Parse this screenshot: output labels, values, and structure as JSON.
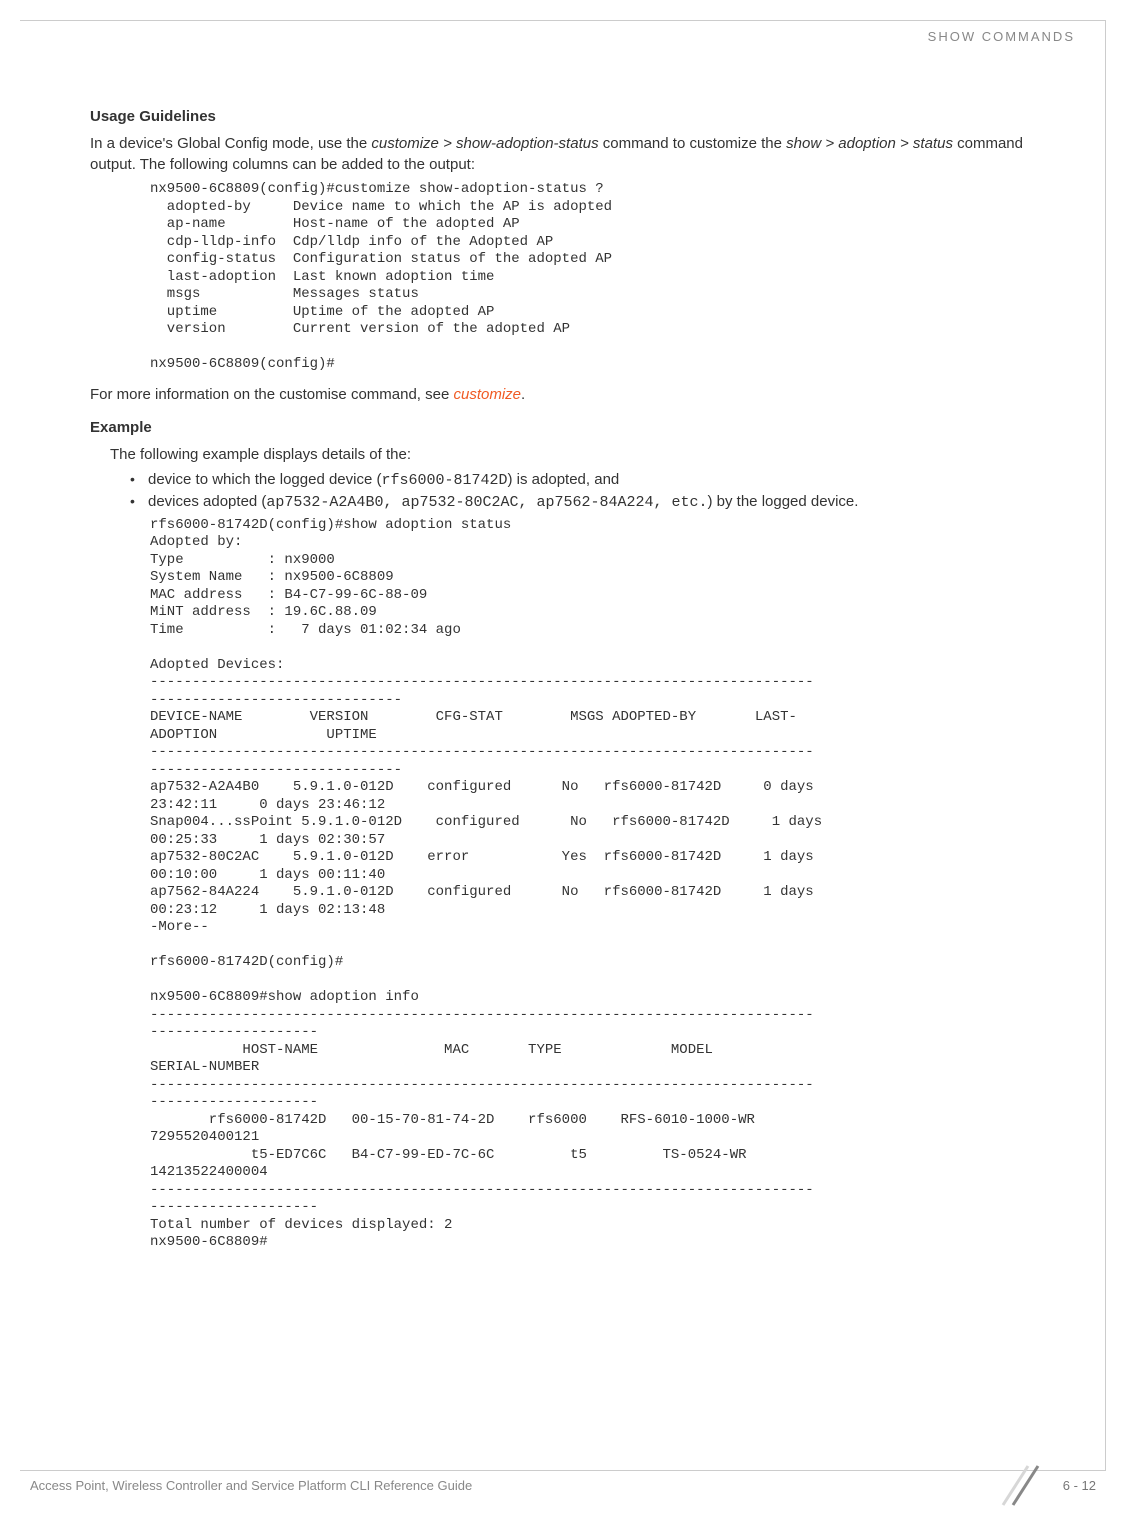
{
  "header": {
    "section_title": "SHOW COMMANDS"
  },
  "usage_guidelines": {
    "heading": "Usage Guidelines",
    "intro_part1": "In a device's Global Config mode, use the ",
    "intro_italic1": "customize > show-adoption-status",
    "intro_part2": " command to customize the ",
    "intro_italic2": "show > adoption > status",
    "intro_part3": " command output. The following columns can be added to the output:",
    "code_block": "nx9500-6C8809(config)#customize show-adoption-status ?\n  adopted-by     Device name to which the AP is adopted\n  ap-name        Host-name of the adopted AP\n  cdp-lldp-info  Cdp/lldp info of the Adopted AP\n  config-status  Configuration status of the adopted AP\n  last-adoption  Last known adoption time\n  msgs           Messages status\n  uptime         Uptime of the adopted AP\n  version        Current version of the adopted AP\n\nnx9500-6C8809(config)#",
    "footer_text_part1": "For more information on the customise command, see ",
    "footer_link": "customize",
    "footer_text_part2": "."
  },
  "example": {
    "heading": "Example",
    "intro": "The following example displays details of the:",
    "bullet1_part1": "device to which the logged device (",
    "bullet1_code": "rfs6000-81742D",
    "bullet1_part2": ") is adopted, and",
    "bullet2_part1": "devices adopted (",
    "bullet2_code": "ap7532-A2A4B0, ap7532-80C2AC, ap7562-84A224, etc.",
    "bullet2_part2": ") by the logged device.",
    "code_block": "rfs6000-81742D(config)#show adoption status\nAdopted by:\nType          : nx9000\nSystem Name   : nx9500-6C8809\nMAC address   : B4-C7-99-6C-88-09\nMiNT address  : 19.6C.88.09\nTime          :   7 days 01:02:34 ago\n\nAdopted Devices:\n-------------------------------------------------------------------------------\n------------------------------\nDEVICE-NAME        VERSION        CFG-STAT        MSGS ADOPTED-BY       LAST-\nADOPTION             UPTIME\n-------------------------------------------------------------------------------\n------------------------------\nap7532-A2A4B0    5.9.1.0-012D    configured      No   rfs6000-81742D     0 days \n23:42:11     0 days 23:46:12\nSnap004...ssPoint 5.9.1.0-012D    configured      No   rfs6000-81742D     1 days \n00:25:33     1 days 02:30:57\nap7532-80C2AC    5.9.1.0-012D    error           Yes  rfs6000-81742D     1 days \n00:10:00     1 days 00:11:40\nap7562-84A224    5.9.1.0-012D    configured      No   rfs6000-81742D     1 days \n00:23:12     1 days 02:13:48\n-More--\n\nrfs6000-81742D(config)#\n\nnx9500-6C8809#show adoption info\n-------------------------------------------------------------------------------\n--------------------\n           HOST-NAME               MAC       TYPE             MODEL       \nSERIAL-NUMBER\n-------------------------------------------------------------------------------\n--------------------\n       rfs6000-81742D   00-15-70-81-74-2D    rfs6000    RFS-6010-1000-WR       \n7295520400121\n            t5-ED7C6C   B4-C7-99-ED-7C-6C         t5         TS-0524-WR      \n14213522400004\n-------------------------------------------------------------------------------\n--------------------\nTotal number of devices displayed: 2\nnx9500-6C8809#"
  },
  "footer": {
    "guide_title": "Access Point, Wireless Controller and Service Platform CLI Reference Guide",
    "page_number": "6 - 12"
  }
}
